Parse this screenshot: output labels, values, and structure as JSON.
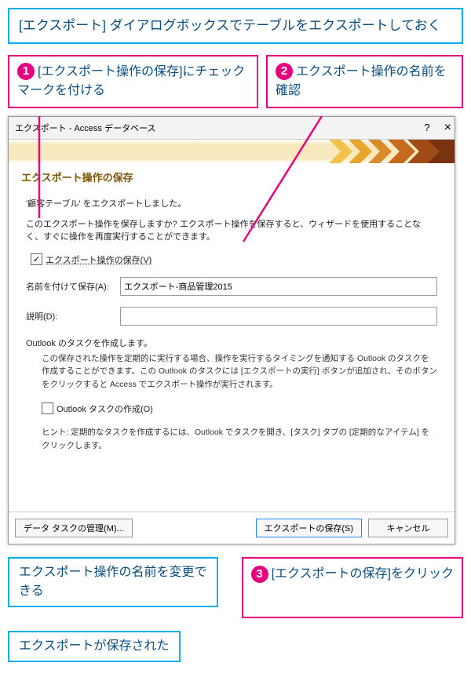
{
  "instructions": {
    "top": "[エクスポート] ダイアログボックスでテーブルをエクスポートしておく",
    "c1_num": "1",
    "c1": "[エクスポート操作の保存]にチェックマークを付ける",
    "c2_num": "2",
    "c2": "エクスポート操作の名前を確認",
    "c3_num": "3",
    "c3": "[エクスポートの保存]をクリック",
    "rename": "エクスポート操作の名前を変更できる",
    "done": "エクスポートが保存された"
  },
  "dialog": {
    "title": "エクスポート - Access データベース",
    "help_icon": "?",
    "close_icon": "×",
    "subtitle": "エクスポート操作の保存",
    "exported_msg": "'顧客テーブル' をエクスポートしました。",
    "save_q": "このエクスポート操作を保存しますか? エクスポート操作を保存すると、ウィザードを使用することなく、すぐに操作を再度実行することができます。",
    "chk_save_label": "エクスポート操作の保存(V)",
    "chk_save_checked": true,
    "name_label": "名前を付けて保存(A):",
    "name_value": "エクスポート-商品管理2015",
    "desc_label": "説明(D):",
    "desc_value": "",
    "outlook_header": "Outlook のタスクを作成します。",
    "outlook_desc": "この保存された操作を定期的に実行する場合、操作を実行するタイミングを通知する Outlook のタスクを作成することができます。この Outlook のタスクには [エクスポートの実行] ボタンが追加され、そのボタンをクリックすると Access でエクスポート操作が実行されます。",
    "chk_outlook_label": "Outlook タスクの作成(O)",
    "chk_outlook_checked": false,
    "hint": "ヒント: 定期的なタスクを作成するには、Outlook でタスクを開き、[タスク] タブの [定期的なアイテム] をクリックします。",
    "btn_manage": "データ タスクの管理(M)...",
    "btn_save": "エクスポートの保存(S)",
    "btn_cancel": "キャンセル"
  }
}
